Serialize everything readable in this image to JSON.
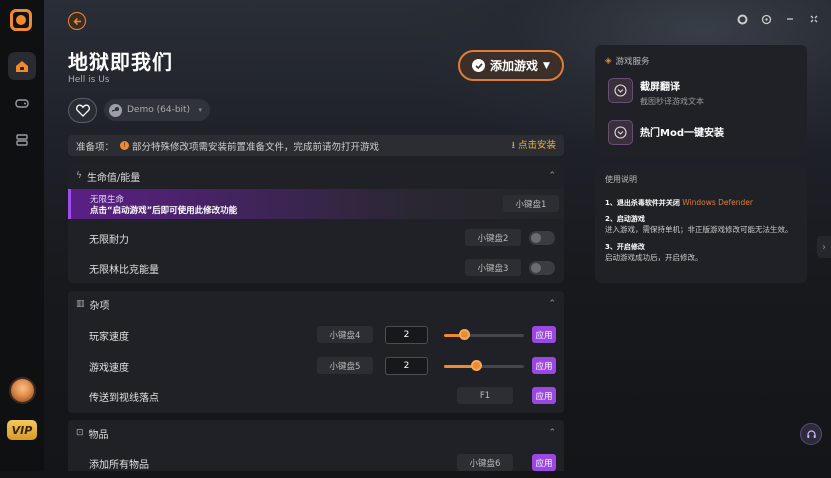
{
  "header": {
    "title": "地狱即我们",
    "subtitle": "Hell is Us",
    "version": "Demo (64-bit)",
    "add_game": "添加游戏"
  },
  "prep": {
    "label": "准备项：",
    "notice": "部分特殊修改项需安装前置准备文件，完成前请勿打开游戏",
    "download": "点击安装"
  },
  "sections": [
    {
      "title": "生命值/能量",
      "rows": [
        {
          "label": "无限生命",
          "promo": "点击“启动游戏”后即可使用此修改功能",
          "key": "小键盘1"
        },
        {
          "label": "无限耐力",
          "key": "小键盘2"
        },
        {
          "label": "无限林比克能量",
          "key": "小键盘3"
        }
      ]
    },
    {
      "title": "杂项",
      "rows": [
        {
          "label": "玩家速度",
          "key": "小键盘4",
          "value": "2",
          "slider_fraction": 0.25,
          "apply": "应用"
        },
        {
          "label": "游戏速度",
          "key": "小键盘5",
          "value": "2",
          "slider_fraction": 0.4,
          "apply": "应用"
        },
        {
          "label": "传送到视线落点",
          "key": "F1",
          "apply": "应用"
        }
      ]
    },
    {
      "title": "物品",
      "rows": [
        {
          "label": "添加所有物品",
          "key": "小键盘6",
          "apply": "应用"
        }
      ]
    }
  ],
  "services": {
    "title": "游戏服务",
    "items": [
      {
        "name": "截屏翻译",
        "desc": "截图秒译游戏文本"
      },
      {
        "name": "热门Mod一键安装",
        "desc": ""
      }
    ]
  },
  "usage": {
    "title": "使用说明",
    "step1_title": "1、退出杀毒软件并关闭",
    "step1_highlight": "Windows Defender",
    "step2_title": "2、启动游戏",
    "step2_text": "进入游戏，需保持单机；非正版游戏修改可能无法生效。",
    "step3_title": "3、开启修改",
    "step3_text": "启动游戏成功后，开启修改。"
  },
  "sidebar": {
    "vip": "VIP"
  },
  "colors": {
    "accent": "#f08a2c",
    "purple": "#9b47e3"
  }
}
